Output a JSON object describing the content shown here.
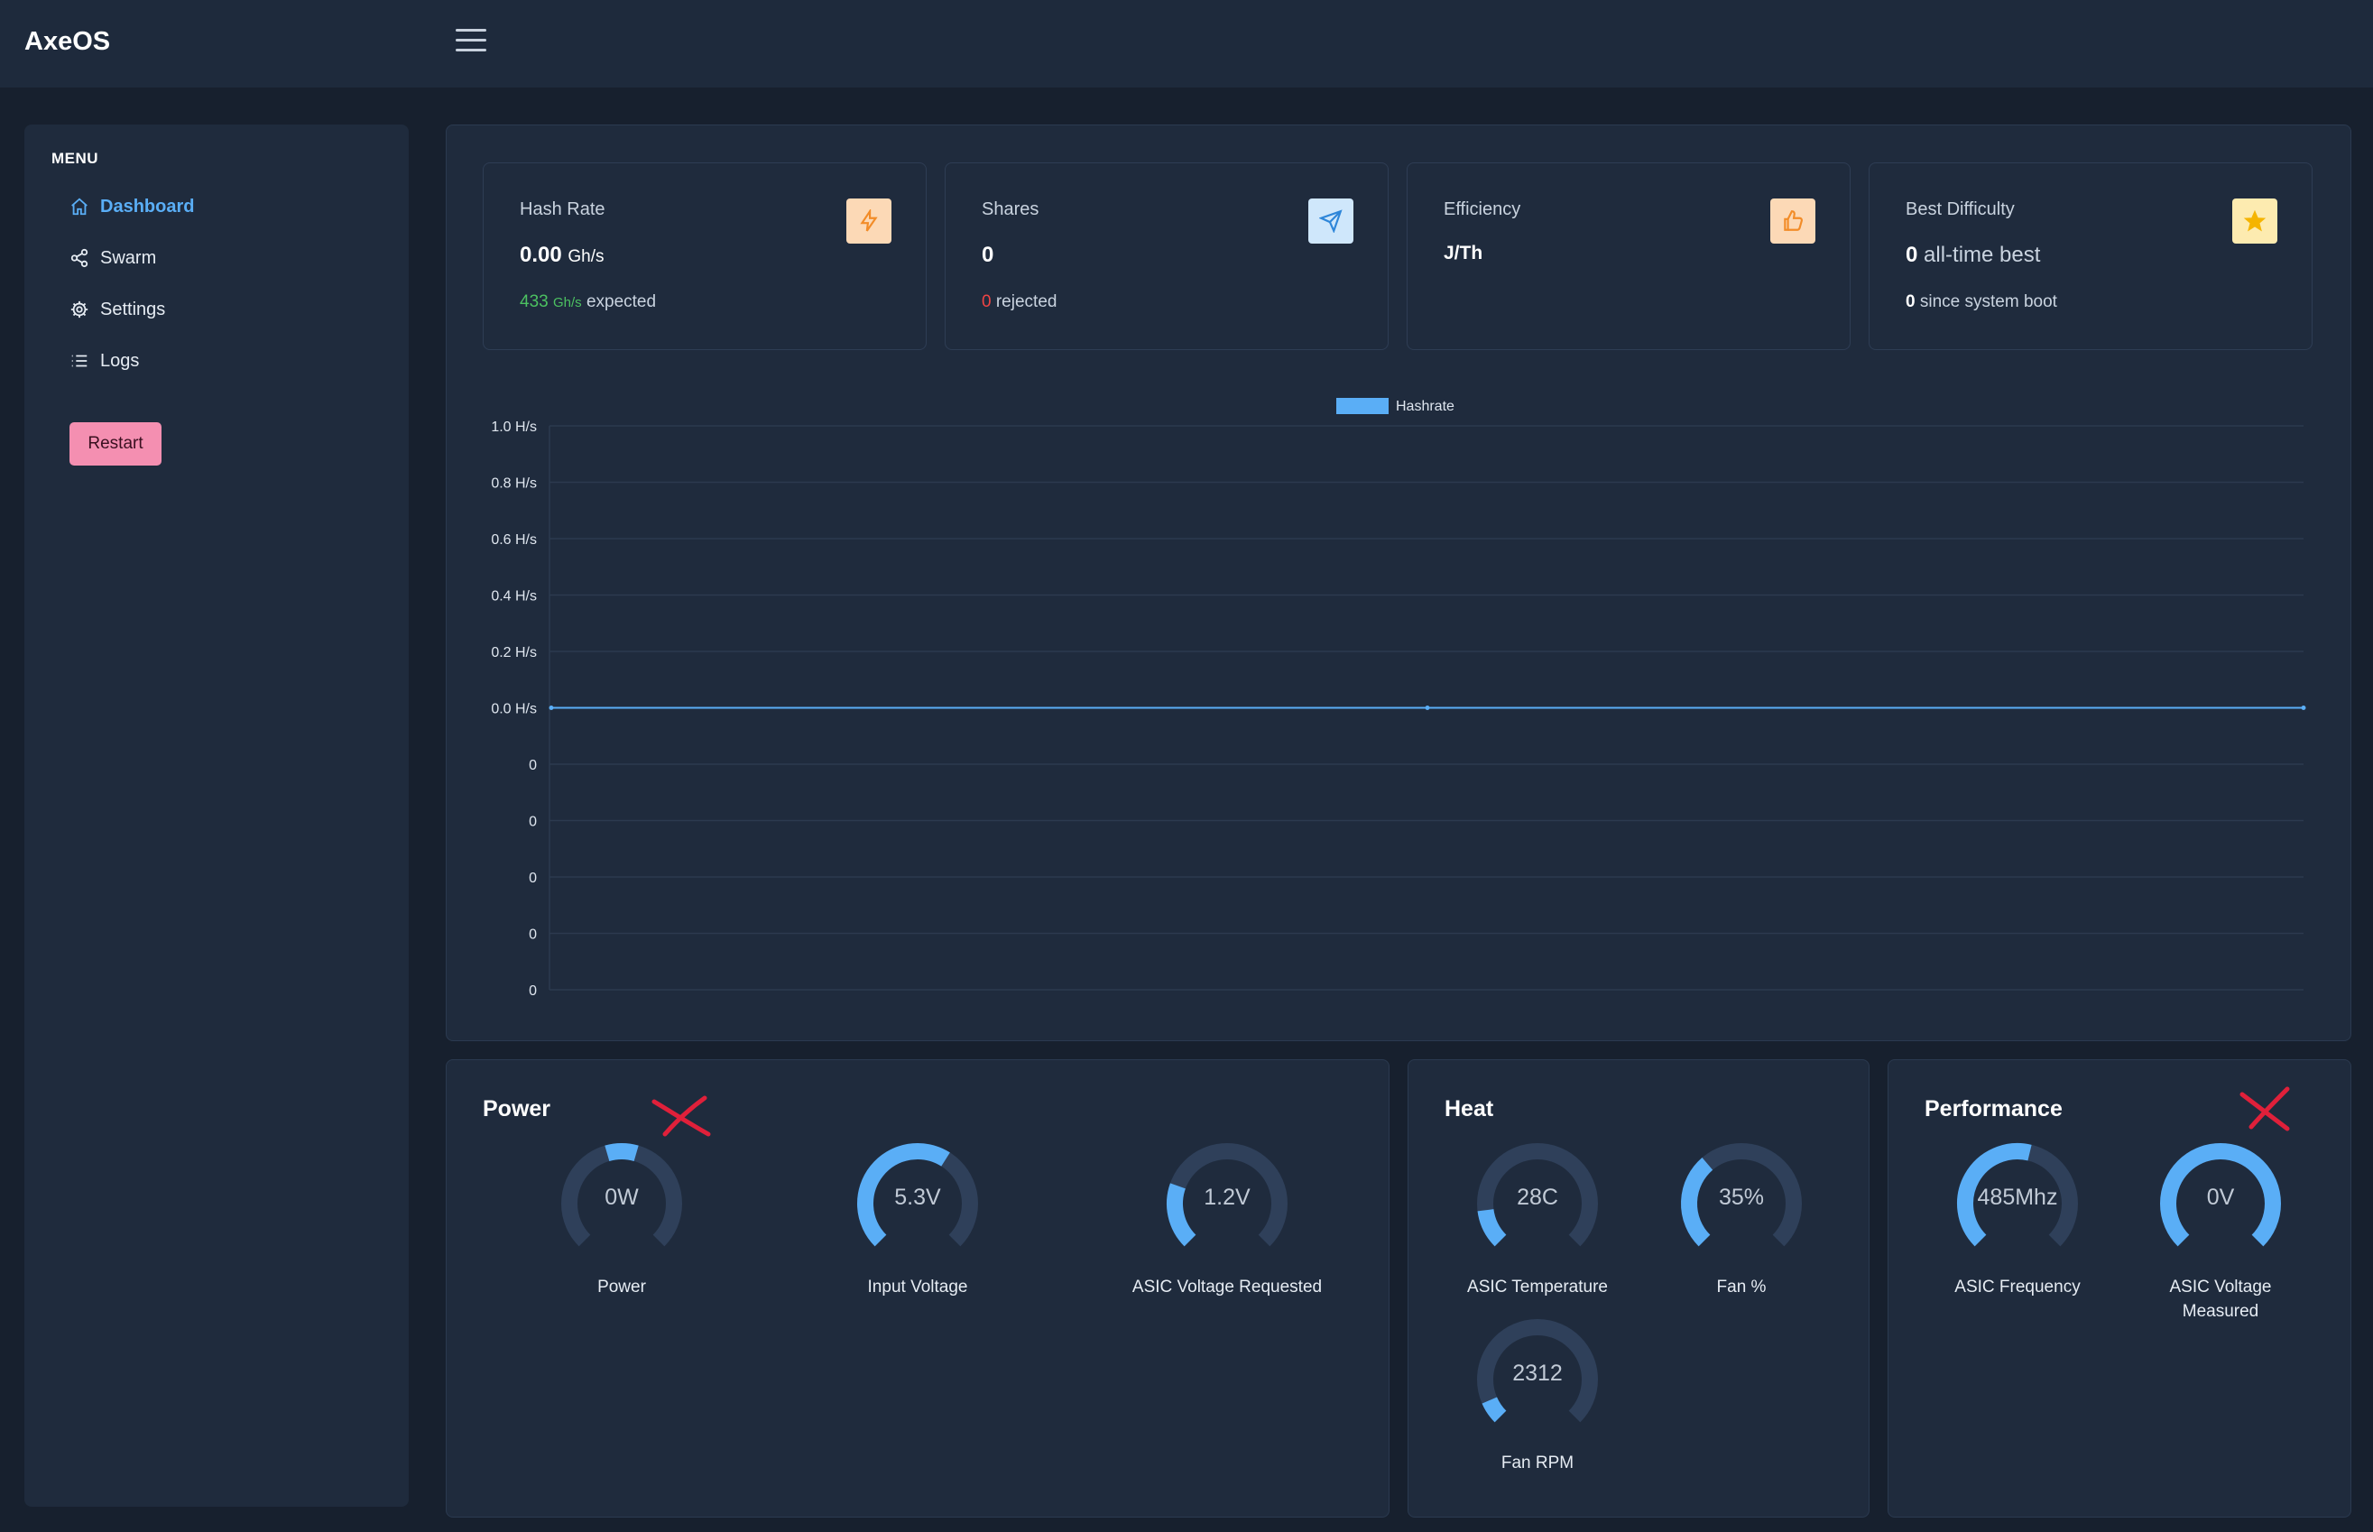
{
  "app": {
    "title": "AxeOS"
  },
  "sidebar": {
    "menu_title": "MENU",
    "items": [
      {
        "label": "Dashboard",
        "icon": "home-icon",
        "active": true
      },
      {
        "label": "Swarm",
        "icon": "share-icon",
        "active": false
      },
      {
        "label": "Settings",
        "icon": "gear-icon",
        "active": false
      },
      {
        "label": "Logs",
        "icon": "list-icon",
        "active": false
      }
    ],
    "restart_label": "Restart"
  },
  "stats": {
    "hashrate": {
      "title": "Hash Rate",
      "value": "0.00",
      "unit": "Gh/s",
      "expected_value": "433",
      "expected_unit": "Gh/s",
      "expected_text": "expected",
      "icon": "bolt-icon"
    },
    "shares": {
      "title": "Shares",
      "value": "0",
      "rejected_value": "0",
      "rejected_text": "rejected",
      "icon": "send-icon"
    },
    "efficiency": {
      "title": "Efficiency",
      "value": "J/Th",
      "icon": "thumbs-up-icon"
    },
    "best_difficulty": {
      "title": "Best Difficulty",
      "value": "0",
      "value_text": "all-time best",
      "since_value": "0",
      "since_text": "since system boot",
      "icon": "star-icon"
    }
  },
  "chart_data": {
    "type": "line",
    "legend": [
      "Hashrate"
    ],
    "legend_position": "top",
    "y_tick_labels": [
      "1.0 H/s",
      "0.8 H/s",
      "0.6 H/s",
      "0.4 H/s",
      "0.2 H/s",
      "0.0 H/s",
      "0",
      "0",
      "0",
      "0",
      "0"
    ],
    "series": [
      {
        "name": "Hashrate",
        "values": [
          0,
          0,
          0
        ]
      }
    ],
    "ylim": [
      0,
      1.0
    ],
    "grid": true,
    "colors": {
      "line": "#5aaef6",
      "legend": "#5aaef6"
    }
  },
  "gauges": {
    "power": {
      "title": "Power",
      "items": [
        {
          "value": "0W",
          "label": "Power",
          "fraction": 0.12,
          "offset": 0.44
        },
        {
          "value": "5.3V",
          "label": "Input Voltage",
          "fraction": 0.62,
          "offset": 0.0
        },
        {
          "value": "1.2V",
          "label": "ASIC Voltage Requested",
          "fraction": 0.24,
          "offset": 0.0
        }
      ]
    },
    "heat": {
      "title": "Heat",
      "items": [
        {
          "value": "28C",
          "label": "ASIC Temperature",
          "fraction": 0.14,
          "offset": 0.0
        },
        {
          "value": "35%",
          "label": "Fan %",
          "fraction": 0.35,
          "offset": 0.0
        },
        {
          "value": "2312",
          "label": "Fan RPM",
          "fraction": 0.08,
          "offset": 0.0
        }
      ]
    },
    "performance": {
      "title": "Performance",
      "items": [
        {
          "value": "485Mhz",
          "label": "ASIC Frequency",
          "fraction": 0.55,
          "offset": 0.0
        },
        {
          "value": "0V",
          "label": "ASIC Voltage Measured",
          "fraction": 1.0,
          "offset": 0.0
        }
      ]
    }
  },
  "colors": {
    "accent": "#5aaef6",
    "gauge_track": "#2f405a",
    "restart": "#f48fb1",
    "cross": "#e0203a"
  }
}
